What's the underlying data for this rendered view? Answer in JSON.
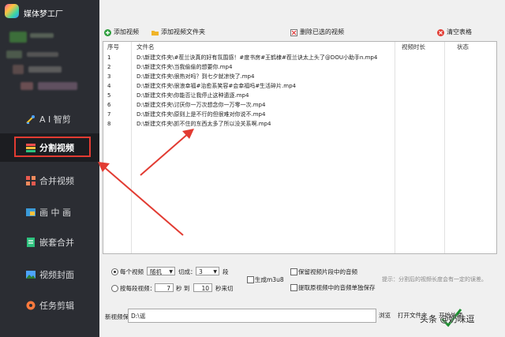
{
  "app": {
    "title": "媒体梦工厂"
  },
  "sidebar": {
    "items": [
      {
        "label": "A I 智剪",
        "icon": "ai-clip-icon"
      },
      {
        "label": "分割视频",
        "icon": "split-video-icon",
        "active": true
      },
      {
        "label": "合并视频",
        "icon": "merge-video-icon"
      },
      {
        "label": "画 中 画",
        "icon": "picture-in-picture-icon"
      },
      {
        "label": "嵌套合并",
        "icon": "nested-merge-icon"
      },
      {
        "label": "视频封面",
        "icon": "video-cover-icon"
      },
      {
        "label": "任务剪辑",
        "icon": "task-edit-icon"
      }
    ]
  },
  "toolbar": {
    "add_video": "添加视频",
    "add_folder": "添加视频文件夹",
    "delete_selected": "删除已选的视频",
    "clear_table": "清空表格"
  },
  "table": {
    "headers": {
      "index": "序号",
      "filename": "文件名",
      "duration": "视频时长",
      "status": "状态"
    },
    "rows": [
      {
        "index": "1",
        "path": "D:\\新建文件夹\\#茬兰诀真的好有氛围感！#度书房#王鹤棣#茬兰诀太上头了@DOU小助手n.mp4"
      },
      {
        "index": "2",
        "path": "D:\\新建文件夹\\当我偷偷的想要你.mp4"
      },
      {
        "index": "3",
        "path": "D:\\新建文件夹\\很热对吗？到七夕就凉快了.mp4"
      },
      {
        "index": "4",
        "path": "D:\\新建文件夹\\很浪幸福#治愈系笑容#会幸福吗#生活碎片.mp4"
      },
      {
        "index": "5",
        "path": "D:\\新建文件夹\\你能否让我停止这种遗逐.mp4"
      },
      {
        "index": "6",
        "path": "D:\\新建文件夹\\讨厌你一万次想念你一万零一次.mp4"
      },
      {
        "index": "7",
        "path": "D:\\新建文件夹\\原则上是不行的但很难对你说不.mp4"
      },
      {
        "index": "8",
        "path": "D:\\新建文件夹\\抓不住的东西太多了所以没关系啊.mp4"
      }
    ]
  },
  "options": {
    "each_video_label": "每个视频",
    "mode_value": "随机",
    "cut_into_label": "切成：",
    "segments_value": "3",
    "segments_unit": "段",
    "by_segment_label": "按每段视频：",
    "from_value": "7",
    "seconds_label": "秒 到",
    "to_value": "10",
    "seconds_cut_label": "秒来切",
    "generate_m3u8": "生成m3u8",
    "keep_audio": "保留视频片段中的音频",
    "extract_audio": "提取原视频中的音频单独保存",
    "hint": "提示：分割后的视频长度会有一定的误差。"
  },
  "save": {
    "label": "新视频保存在：",
    "path": "D:\\谣",
    "browse": "浏览",
    "open_folder": "打开文件夹",
    "start": "开始处理"
  },
  "watermark": "头条 @奶味逗",
  "colors": {
    "sidebar_bg": "#2b2d33",
    "highlight": "#e23b32",
    "active_bg": "#1c1d21"
  }
}
